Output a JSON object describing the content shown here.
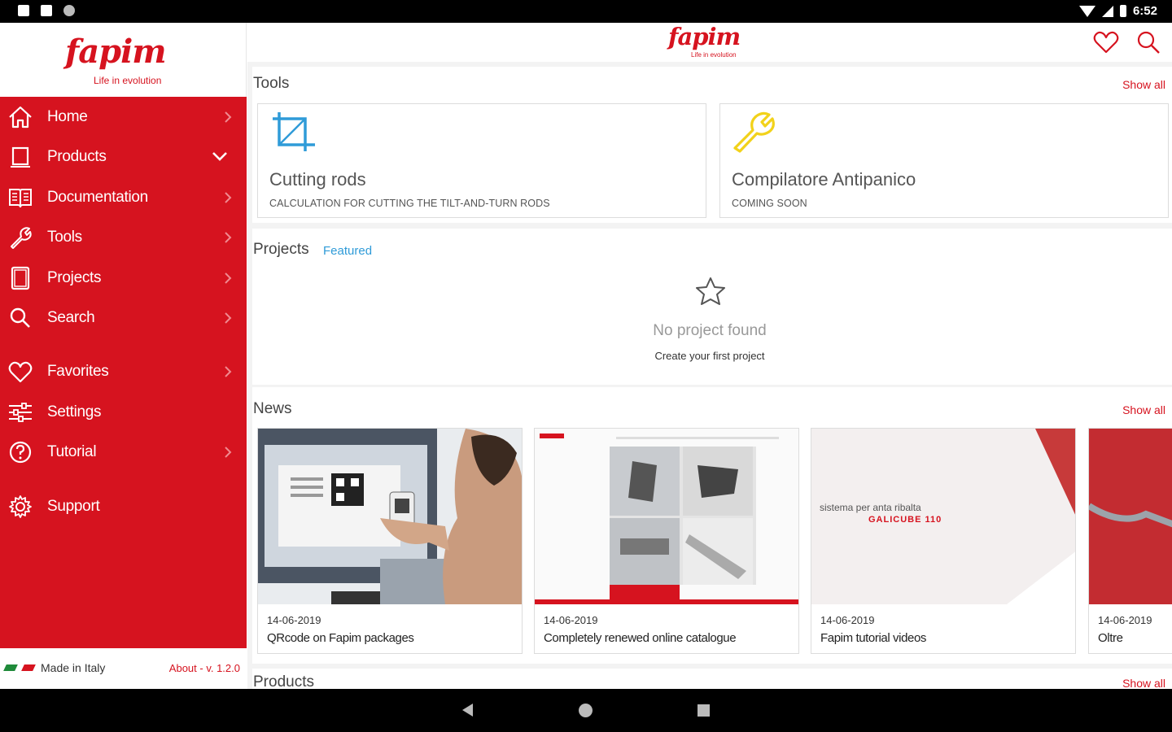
{
  "status_bar": {
    "time": "6:52"
  },
  "brand": {
    "name": "fapim",
    "tagline": "Life in evolution",
    "color": "#d6131f"
  },
  "sidebar": {
    "items": [
      {
        "label": "Home",
        "icon": "home-icon",
        "chevron": "right"
      },
      {
        "label": "Products",
        "icon": "products-icon",
        "chevron": "down"
      },
      {
        "label": "Documentation",
        "icon": "book-icon",
        "chevron": "right"
      },
      {
        "label": "Tools",
        "icon": "wrench-icon",
        "chevron": "right"
      },
      {
        "label": "Projects",
        "icon": "projects-icon",
        "chevron": "right"
      },
      {
        "label": "Search",
        "icon": "search-icon",
        "chevron": "right"
      },
      {
        "label": "Favorites",
        "icon": "heart-icon",
        "chevron": "right"
      },
      {
        "label": "Settings",
        "icon": "sliders-icon",
        "chevron": "none"
      },
      {
        "label": "Tutorial",
        "icon": "help-icon",
        "chevron": "right"
      },
      {
        "label": "Support",
        "icon": "gear-icon",
        "chevron": "none"
      }
    ],
    "footer": {
      "made_in": "Made in Italy",
      "about": "About - v. 1.2.0"
    }
  },
  "main": {
    "tools": {
      "title": "Tools",
      "show_all": "Show all",
      "cards": [
        {
          "title": "Cutting rods",
          "subtitle": "CALCULATION FOR CUTTING THE TILT-AND-TURN RODS",
          "icon": "crop-icon",
          "icon_color": "#2f9bd8"
        },
        {
          "title": "Compilatore Antipanico",
          "subtitle": "COMING SOON",
          "icon": "wrench-icon",
          "icon_color": "#f2d21a"
        }
      ]
    },
    "projects": {
      "title": "Projects",
      "filter": "Featured",
      "empty_title": "No project found",
      "empty_subtitle": "Create your first project"
    },
    "news": {
      "title": "News",
      "show_all": "Show all",
      "items": [
        {
          "date": "14-06-2019",
          "title": "QRcode on Fapim packages"
        },
        {
          "date": "14-06-2019",
          "title": "Completely renewed online catalogue"
        },
        {
          "date": "14-06-2019",
          "title": "Fapim tutorial videos",
          "image_text_1": "sistema per anta ribalta",
          "image_text_2": "GALICUBE 110"
        },
        {
          "date": "14-06-2019",
          "title": "Oltre"
        }
      ]
    },
    "products": {
      "title": "Products",
      "show_all": "Show all"
    }
  }
}
